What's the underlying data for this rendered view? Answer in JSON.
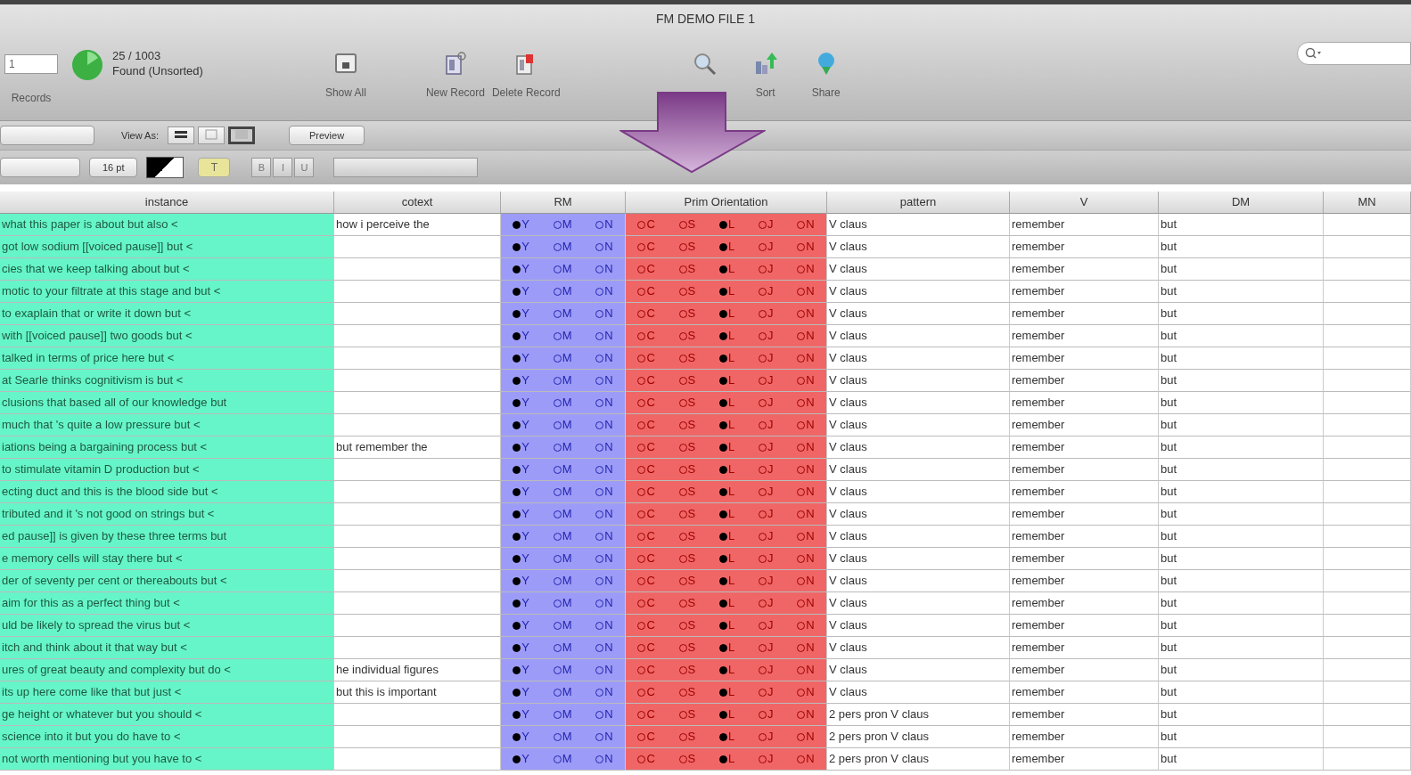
{
  "window": {
    "title": "FM DEMO FILE 1"
  },
  "toolbar": {
    "record_field": {
      "value": "1"
    },
    "records_label": "Records",
    "found_count": "25 / 1003",
    "found_status": "Found (Unsorted)",
    "buttons": [
      {
        "kind": "show-all",
        "label": "Show All"
      },
      {
        "kind": "new",
        "label": "New Record"
      },
      {
        "kind": "delete",
        "label": "Delete Record"
      },
      {
        "kind": "find"
      },
      {
        "kind": "sort",
        "label": "Sort"
      },
      {
        "kind": "share",
        "label": "Share"
      }
    ]
  },
  "layout_bar": {
    "view_as_label": "View As:",
    "views": [
      {
        "kind": "form",
        "selected": false
      },
      {
        "kind": "list",
        "selected": false
      },
      {
        "kind": "table",
        "selected": true
      }
    ],
    "preview": "Preview"
  },
  "format_bar": {
    "font_size": "16 pt",
    "highlight": "T",
    "style_buttons": [
      "B",
      "I",
      "U"
    ]
  },
  "table": {
    "columns": [
      "instance",
      "cotext",
      "RM",
      "Prim Orientation",
      "pattern",
      "V",
      "DM",
      "MN"
    ],
    "rows": [
      {
        "instance": "what this paper is about but also <",
        "cotext": "how i perceive the",
        "rm": [
          {
            "label": "Y",
            "selected": true
          },
          {
            "label": "M",
            "selected": false
          },
          {
            "label": "N",
            "selected": false
          }
        ],
        "orientation": [
          {
            "label": "C",
            "selected": false
          },
          {
            "label": "S",
            "selected": false
          },
          {
            "label": "L",
            "selected": true
          },
          {
            "label": "J",
            "selected": false
          },
          {
            "label": "N",
            "selected": false
          }
        ],
        "pattern": "V claus",
        "v": "remember",
        "dm": "but"
      },
      {
        "instance": "got low sodium [[voiced pause]] but <",
        "rm": [
          {
            "label": "Y",
            "selected": true
          },
          {
            "label": "M",
            "selected": false
          },
          {
            "label": "N",
            "selected": false
          }
        ],
        "orientation": [
          {
            "label": "C",
            "selected": false
          },
          {
            "label": "S",
            "selected": false
          },
          {
            "label": "L",
            "selected": true
          },
          {
            "label": "J",
            "selected": false
          },
          {
            "label": "N",
            "selected": false
          }
        ],
        "pattern": "V claus",
        "v": "remember",
        "dm": "but"
      },
      {
        "instance": "cies that we keep talking about but <",
        "rm": [
          {
            "label": "Y",
            "selected": true
          },
          {
            "label": "M",
            "selected": false
          },
          {
            "label": "N",
            "selected": false
          }
        ],
        "orientation": [
          {
            "label": "C",
            "selected": false
          },
          {
            "label": "S",
            "selected": false
          },
          {
            "label": "L",
            "selected": true
          },
          {
            "label": "J",
            "selected": false
          },
          {
            "label": "N",
            "selected": false
          }
        ],
        "pattern": "V claus",
        "v": "remember",
        "dm": "but"
      },
      {
        "instance": "motic to your filtrate at this stage and but <",
        "rm": [
          {
            "label": "Y",
            "selected": true
          },
          {
            "label": "M",
            "selected": false
          },
          {
            "label": "N",
            "selected": false
          }
        ],
        "orientation": [
          {
            "label": "C",
            "selected": false
          },
          {
            "label": "S",
            "selected": false
          },
          {
            "label": "L",
            "selected": true
          },
          {
            "label": "J",
            "selected": false
          },
          {
            "label": "N",
            "selected": false
          }
        ],
        "pattern": "V claus",
        "v": "remember",
        "dm": "but"
      },
      {
        "instance": "to exaplain that or write it down but <",
        "rm": [
          {
            "label": "Y",
            "selected": true
          },
          {
            "label": "M",
            "selected": false
          },
          {
            "label": "N",
            "selected": false
          }
        ],
        "orientation": [
          {
            "label": "C",
            "selected": false
          },
          {
            "label": "S",
            "selected": false
          },
          {
            "label": "L",
            "selected": true
          },
          {
            "label": "J",
            "selected": false
          },
          {
            "label": "N",
            "selected": false
          }
        ],
        "pattern": "V claus",
        "v": "remember",
        "dm": "but"
      },
      {
        "instance": "with [[voiced pause]] two goods but <",
        "rm": [
          {
            "label": "Y",
            "selected": true
          },
          {
            "label": "M",
            "selected": false
          },
          {
            "label": "N",
            "selected": false
          }
        ],
        "orientation": [
          {
            "label": "C",
            "selected": false
          },
          {
            "label": "S",
            "selected": false
          },
          {
            "label": "L",
            "selected": true
          },
          {
            "label": "J",
            "selected": false
          },
          {
            "label": "N",
            "selected": false
          }
        ],
        "pattern": "V claus",
        "v": "remember",
        "dm": "but"
      },
      {
        "instance": "talked in terms of price here but <",
        "rm": [
          {
            "label": "Y",
            "selected": true
          },
          {
            "label": "M",
            "selected": false
          },
          {
            "label": "N",
            "selected": false
          }
        ],
        "orientation": [
          {
            "label": "C",
            "selected": false
          },
          {
            "label": "S",
            "selected": false
          },
          {
            "label": "L",
            "selected": true
          },
          {
            "label": "J",
            "selected": false
          },
          {
            "label": "N",
            "selected": false
          }
        ],
        "pattern": "V claus",
        "v": "remember",
        "dm": "but"
      },
      {
        "instance": "at Searle thinks cognitivism is but <",
        "rm": [
          {
            "label": "Y",
            "selected": true
          },
          {
            "label": "M",
            "selected": false
          },
          {
            "label": "N",
            "selected": false
          }
        ],
        "orientation": [
          {
            "label": "C",
            "selected": false
          },
          {
            "label": "S",
            "selected": false
          },
          {
            "label": "L",
            "selected": true
          },
          {
            "label": "J",
            "selected": false
          },
          {
            "label": "N",
            "selected": false
          }
        ],
        "pattern": "V claus",
        "v": "remember",
        "dm": "but"
      },
      {
        "instance": "clusions that based all of our knowledge but",
        "rm": [
          {
            "label": "Y",
            "selected": true
          },
          {
            "label": "M",
            "selected": false
          },
          {
            "label": "N",
            "selected": false
          }
        ],
        "orientation": [
          {
            "label": "C",
            "selected": false
          },
          {
            "label": "S",
            "selected": false
          },
          {
            "label": "L",
            "selected": true
          },
          {
            "label": "J",
            "selected": false
          },
          {
            "label": "N",
            "selected": false
          }
        ],
        "pattern": "V claus",
        "v": "remember",
        "dm": "but"
      },
      {
        "instance": "much that 's quite a low pressure but <",
        "rm": [
          {
            "label": "Y",
            "selected": true
          },
          {
            "label": "M",
            "selected": false
          },
          {
            "label": "N",
            "selected": false
          }
        ],
        "orientation": [
          {
            "label": "C",
            "selected": false
          },
          {
            "label": "S",
            "selected": false
          },
          {
            "label": "L",
            "selected": true
          },
          {
            "label": "J",
            "selected": false
          },
          {
            "label": "N",
            "selected": false
          }
        ],
        "pattern": "V claus",
        "v": "remember",
        "dm": "but"
      },
      {
        "instance": "iations being a bargaining process but <",
        "cotext": "but remember the",
        "rm": [
          {
            "label": "Y",
            "selected": true
          },
          {
            "label": "M",
            "selected": false
          },
          {
            "label": "N",
            "selected": false
          }
        ],
        "orientation": [
          {
            "label": "C",
            "selected": false
          },
          {
            "label": "S",
            "selected": false
          },
          {
            "label": "L",
            "selected": true
          },
          {
            "label": "J",
            "selected": false
          },
          {
            "label": "N",
            "selected": false
          }
        ],
        "pattern": "V claus",
        "v": "remember",
        "dm": "but"
      },
      {
        "instance": "to stimulate vitamin D production but <",
        "rm": [
          {
            "label": "Y",
            "selected": true
          },
          {
            "label": "M",
            "selected": false
          },
          {
            "label": "N",
            "selected": false
          }
        ],
        "orientation": [
          {
            "label": "C",
            "selected": false
          },
          {
            "label": "S",
            "selected": false
          },
          {
            "label": "L",
            "selected": true
          },
          {
            "label": "J",
            "selected": false
          },
          {
            "label": "N",
            "selected": false
          }
        ],
        "pattern": "V claus",
        "v": "remember",
        "dm": "but"
      },
      {
        "instance": "ecting duct and this is the blood side but <",
        "rm": [
          {
            "label": "Y",
            "selected": true
          },
          {
            "label": "M",
            "selected": false
          },
          {
            "label": "N",
            "selected": false
          }
        ],
        "orientation": [
          {
            "label": "C",
            "selected": false
          },
          {
            "label": "S",
            "selected": false
          },
          {
            "label": "L",
            "selected": true
          },
          {
            "label": "J",
            "selected": false
          },
          {
            "label": "N",
            "selected": false
          }
        ],
        "pattern": "V claus",
        "v": "remember",
        "dm": "but"
      },
      {
        "instance": "tributed and it 's not good on strings but <",
        "rm": [
          {
            "label": "Y",
            "selected": true
          },
          {
            "label": "M",
            "selected": false
          },
          {
            "label": "N",
            "selected": false
          }
        ],
        "orientation": [
          {
            "label": "C",
            "selected": false
          },
          {
            "label": "S",
            "selected": false
          },
          {
            "label": "L",
            "selected": true
          },
          {
            "label": "J",
            "selected": false
          },
          {
            "label": "N",
            "selected": false
          }
        ],
        "pattern": "V claus",
        "v": "remember",
        "dm": "but"
      },
      {
        "instance": "ed pause]] is given by these three terms but",
        "rm": [
          {
            "label": "Y",
            "selected": true
          },
          {
            "label": "M",
            "selected": false
          },
          {
            "label": "N",
            "selected": false
          }
        ],
        "orientation": [
          {
            "label": "C",
            "selected": false
          },
          {
            "label": "S",
            "selected": false
          },
          {
            "label": "L",
            "selected": true
          },
          {
            "label": "J",
            "selected": false
          },
          {
            "label": "N",
            "selected": false
          }
        ],
        "pattern": "V claus",
        "v": "remember",
        "dm": "but"
      },
      {
        "instance": "e memory cells will stay there but <",
        "rm": [
          {
            "label": "Y",
            "selected": true
          },
          {
            "label": "M",
            "selected": false
          },
          {
            "label": "N",
            "selected": false
          }
        ],
        "orientation": [
          {
            "label": "C",
            "selected": false
          },
          {
            "label": "S",
            "selected": false
          },
          {
            "label": "L",
            "selected": true
          },
          {
            "label": "J",
            "selected": false
          },
          {
            "label": "N",
            "selected": false
          }
        ],
        "pattern": "V claus",
        "v": "remember",
        "dm": "but"
      },
      {
        "instance": "der of seventy per cent or thereabouts but <",
        "rm": [
          {
            "label": "Y",
            "selected": true
          },
          {
            "label": "M",
            "selected": false
          },
          {
            "label": "N",
            "selected": false
          }
        ],
        "orientation": [
          {
            "label": "C",
            "selected": false
          },
          {
            "label": "S",
            "selected": false
          },
          {
            "label": "L",
            "selected": true
          },
          {
            "label": "J",
            "selected": false
          },
          {
            "label": "N",
            "selected": false
          }
        ],
        "pattern": "V claus",
        "v": "remember",
        "dm": "but"
      },
      {
        "instance": "aim for this as a perfect thing but <",
        "rm": [
          {
            "label": "Y",
            "selected": true
          },
          {
            "label": "M",
            "selected": false
          },
          {
            "label": "N",
            "selected": false
          }
        ],
        "orientation": [
          {
            "label": "C",
            "selected": false
          },
          {
            "label": "S",
            "selected": false
          },
          {
            "label": "L",
            "selected": true
          },
          {
            "label": "J",
            "selected": false
          },
          {
            "label": "N",
            "selected": false
          }
        ],
        "pattern": "V claus",
        "v": "remember",
        "dm": "but"
      },
      {
        "instance": "uld be likely to spread the virus but <",
        "rm": [
          {
            "label": "Y",
            "selected": true
          },
          {
            "label": "M",
            "selected": false
          },
          {
            "label": "N",
            "selected": false
          }
        ],
        "orientation": [
          {
            "label": "C",
            "selected": false
          },
          {
            "label": "S",
            "selected": false
          },
          {
            "label": "L",
            "selected": true
          },
          {
            "label": "J",
            "selected": false
          },
          {
            "label": "N",
            "selected": false
          }
        ],
        "pattern": "V claus",
        "v": "remember",
        "dm": "but"
      },
      {
        "instance": "itch and think about it that way but <",
        "rm": [
          {
            "label": "Y",
            "selected": true
          },
          {
            "label": "M",
            "selected": false
          },
          {
            "label": "N",
            "selected": false
          }
        ],
        "orientation": [
          {
            "label": "C",
            "selected": false
          },
          {
            "label": "S",
            "selected": false
          },
          {
            "label": "L",
            "selected": true
          },
          {
            "label": "J",
            "selected": false
          },
          {
            "label": "N",
            "selected": false
          }
        ],
        "pattern": "V claus",
        "v": "remember",
        "dm": "but"
      },
      {
        "instance": "ures of great beauty and complexity but do <",
        "cotext": "he individual figures",
        "rm": [
          {
            "label": "Y",
            "selected": true
          },
          {
            "label": "M",
            "selected": false
          },
          {
            "label": "N",
            "selected": false
          }
        ],
        "orientation": [
          {
            "label": "C",
            "selected": false
          },
          {
            "label": "S",
            "selected": false
          },
          {
            "label": "L",
            "selected": true
          },
          {
            "label": "J",
            "selected": false
          },
          {
            "label": "N",
            "selected": false
          }
        ],
        "pattern": "V claus",
        "v": "remember",
        "dm": "but"
      },
      {
        "instance": "its up here come like that but just <",
        "cotext": "but this is important",
        "rm": [
          {
            "label": "Y",
            "selected": true
          },
          {
            "label": "M",
            "selected": false
          },
          {
            "label": "N",
            "selected": false
          }
        ],
        "orientation": [
          {
            "label": "C",
            "selected": false
          },
          {
            "label": "S",
            "selected": false
          },
          {
            "label": "L",
            "selected": true
          },
          {
            "label": "J",
            "selected": false
          },
          {
            "label": "N",
            "selected": false
          }
        ],
        "pattern": "V claus",
        "v": "remember",
        "dm": "but"
      },
      {
        "instance": "ge height or whatever but you should <",
        "rm": [
          {
            "label": "Y",
            "selected": true
          },
          {
            "label": "M",
            "selected": false
          },
          {
            "label": "N",
            "selected": false
          }
        ],
        "orientation": [
          {
            "label": "C",
            "selected": false
          },
          {
            "label": "S",
            "selected": false
          },
          {
            "label": "L",
            "selected": true
          },
          {
            "label": "J",
            "selected": false
          },
          {
            "label": "N",
            "selected": false
          }
        ],
        "pattern": "2 pers pron V claus",
        "v": "remember",
        "dm": "but"
      },
      {
        "instance": "science into it but you do have to <",
        "rm": [
          {
            "label": "Y",
            "selected": true
          },
          {
            "label": "M",
            "selected": false
          },
          {
            "label": "N",
            "selected": false
          }
        ],
        "orientation": [
          {
            "label": "C",
            "selected": false
          },
          {
            "label": "S",
            "selected": false
          },
          {
            "label": "L",
            "selected": true
          },
          {
            "label": "J",
            "selected": false
          },
          {
            "label": "N",
            "selected": false
          }
        ],
        "pattern": "2 pers pron V claus",
        "v": "remember",
        "dm": "but"
      },
      {
        "instance": "not worth mentioning but you have to <",
        "rm": [
          {
            "label": "Y",
            "selected": true
          },
          {
            "label": "M",
            "selected": false
          },
          {
            "label": "N",
            "selected": false
          }
        ],
        "orientation": [
          {
            "label": "C",
            "selected": false
          },
          {
            "label": "S",
            "selected": false
          },
          {
            "label": "L",
            "selected": true
          },
          {
            "label": "J",
            "selected": false
          },
          {
            "label": "N",
            "selected": false
          }
        ],
        "pattern": "2 pers pron V claus",
        "v": "remember",
        "dm": "but"
      }
    ]
  }
}
